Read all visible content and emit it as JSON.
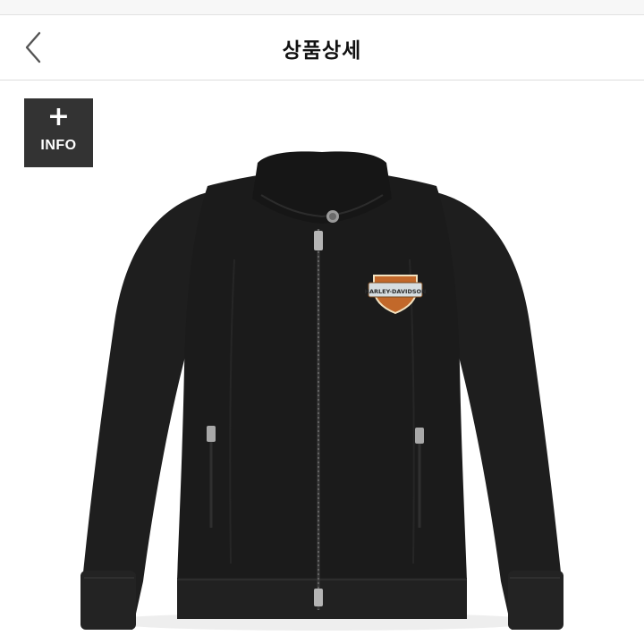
{
  "header": {
    "title": "상품상세",
    "back_icon": "chevron-left-icon"
  },
  "info_button": {
    "icon": "plus-icon",
    "label": "INFO"
  },
  "product_image": {
    "description": "black zip jacket with orange bar-and-shield logo patch",
    "logo_text": "HARLEY-DAVIDSON",
    "colors": {
      "jacket": "#1c1c1c",
      "patch_orange": "#c2682a",
      "info_button_bg": "#333333"
    }
  }
}
